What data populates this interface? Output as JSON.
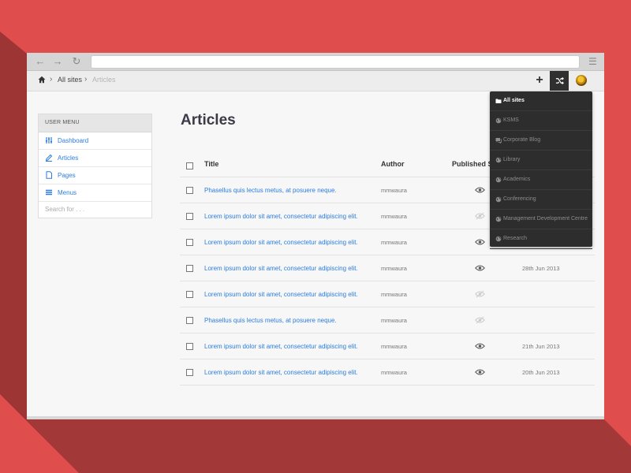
{
  "breadcrumb": {
    "items": [
      "All sites",
      "Articles"
    ]
  },
  "sidebar": {
    "header": "USER MENU",
    "items": [
      {
        "label": "Dashboard",
        "icon": "sliders-icon"
      },
      {
        "label": "Articles",
        "icon": "pencil-icon"
      },
      {
        "label": "Pages",
        "icon": "page-icon"
      },
      {
        "label": "Menus",
        "icon": "list-icon"
      }
    ],
    "search_placeholder": "Search for . . ."
  },
  "main": {
    "title": "Articles",
    "columns": [
      "Title",
      "Author",
      "Published S"
    ],
    "rows": [
      {
        "title": "Phasellus quis lectus metus, at posuere neque.",
        "author": "mmwaura",
        "published": true,
        "date": ""
      },
      {
        "title": "Lorem ipsum dolor sit amet, consectetur adipiscing elit.",
        "author": "mmwaura",
        "published": false,
        "date": ""
      },
      {
        "title": "Lorem ipsum dolor sit amet, consectetur adipiscing elit.",
        "author": "mmwaura",
        "published": true,
        "date": ""
      },
      {
        "title": "Lorem ipsum dolor sit amet, consectetur adipiscing elit.",
        "author": "mmwaura",
        "published": true,
        "date": "28th Jun 2013"
      },
      {
        "title": "Lorem ipsum dolor sit amet, consectetur adipiscing elit.",
        "author": "mmwaura",
        "published": false,
        "date": ""
      },
      {
        "title": "Phasellus quis lectus metus, at posuere neque.",
        "author": "mmwaura",
        "published": false,
        "date": ""
      },
      {
        "title": "Lorem ipsum dolor sit amet, consectetur adipiscing elit.",
        "author": "mmwaura",
        "published": true,
        "date": "21th Jun 2013"
      },
      {
        "title": "Lorem ipsum dolor sit amet, consectetur adipiscing elit.",
        "author": "mmwaura",
        "published": true,
        "date": "20th Jun 2013"
      }
    ]
  },
  "sites_dropdown": {
    "items": [
      {
        "label": "All sites",
        "icon": "folder-icon",
        "active": true
      },
      {
        "label": "KSMS",
        "icon": "globe-icon",
        "active": false
      },
      {
        "label": "Corporate Blog",
        "icon": "chat-icon",
        "active": false
      },
      {
        "label": "Library",
        "icon": "globe-icon",
        "active": false
      },
      {
        "label": "Academics",
        "icon": "globe-icon",
        "active": false
      },
      {
        "label": "Conferencing",
        "icon": "globe-icon",
        "active": false
      },
      {
        "label": "Management Development Centre",
        "icon": "globe-icon",
        "active": false
      },
      {
        "label": "Research",
        "icon": "globe-icon",
        "active": false
      }
    ]
  },
  "colors": {
    "background": "#e04d4d",
    "link": "#2b7de0",
    "dropdown_bg": "#2d2d2d"
  }
}
